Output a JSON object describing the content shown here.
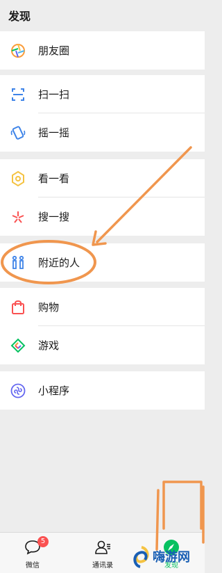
{
  "header": {
    "title": "发现"
  },
  "items": [
    {
      "label": "朋友圈",
      "icon": "moments-icon"
    },
    {
      "label": "扫一扫",
      "icon": "scan-icon"
    },
    {
      "label": "摇一摇",
      "icon": "shake-icon"
    },
    {
      "label": "看一看",
      "icon": "top-stories-icon"
    },
    {
      "label": "搜一搜",
      "icon": "search-icon"
    },
    {
      "label": "附近的人",
      "icon": "people-nearby-icon"
    },
    {
      "label": "购物",
      "icon": "shopping-bag-icon"
    },
    {
      "label": "游戏",
      "icon": "games-icon"
    },
    {
      "label": "小程序",
      "icon": "mini-programs-icon"
    }
  ],
  "tabbar": {
    "tabs": [
      {
        "label": "微信",
        "badge": "5",
        "icon": "chat-icon"
      },
      {
        "label": "通讯录",
        "icon": "contacts-icon"
      },
      {
        "label": "发现",
        "icon": "discover-icon"
      }
    ]
  },
  "watermark": {
    "text": "嗨游网"
  },
  "colors": {
    "annotation": "#f0964e",
    "badge": "#fa5151",
    "discover_active": "#07c160"
  }
}
